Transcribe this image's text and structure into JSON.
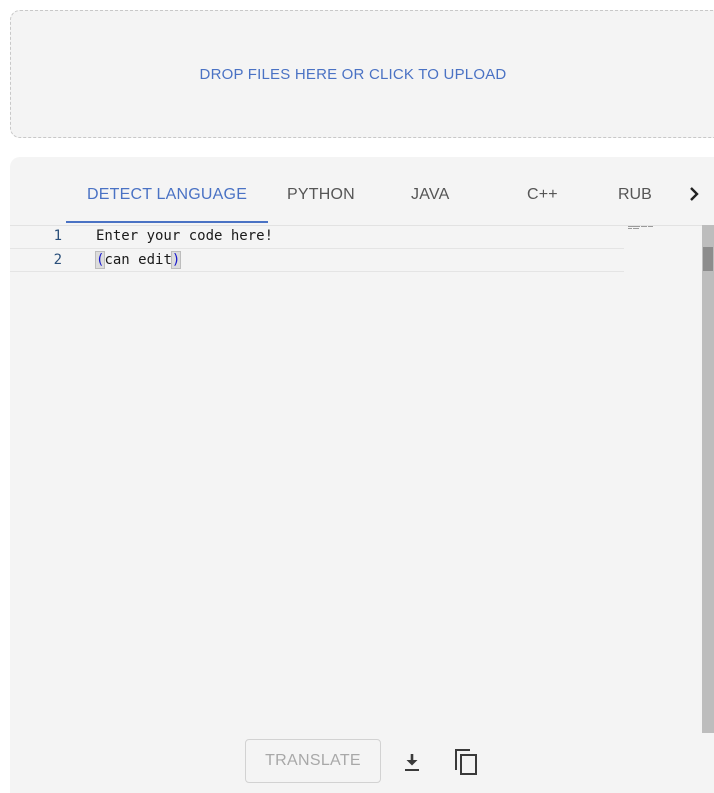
{
  "dropzone": {
    "label": "DROP FILES HERE OR CLICK TO UPLOAD"
  },
  "tabs": {
    "items": [
      {
        "label": "DETECT LANGUAGE",
        "active": true
      },
      {
        "label": "PYTHON",
        "active": false
      },
      {
        "label": "JAVA",
        "active": false
      },
      {
        "label": "C++",
        "active": false
      },
      {
        "label": "RUBY",
        "active": false
      }
    ],
    "next_icon": "chevron-right-icon"
  },
  "editor": {
    "lines": [
      {
        "number": "1",
        "text": "Enter your code here!"
      },
      {
        "number": "2",
        "open": "(",
        "text": "can edit",
        "close": ")"
      }
    ]
  },
  "toolbar": {
    "translate_label": "TRANSLATE",
    "download_icon": "download-icon",
    "copy_icon": "copy-icon"
  },
  "colors": {
    "accent": "#4a72c4",
    "background": "#f4f4f4",
    "disabled_text": "#a8a8a8"
  }
}
